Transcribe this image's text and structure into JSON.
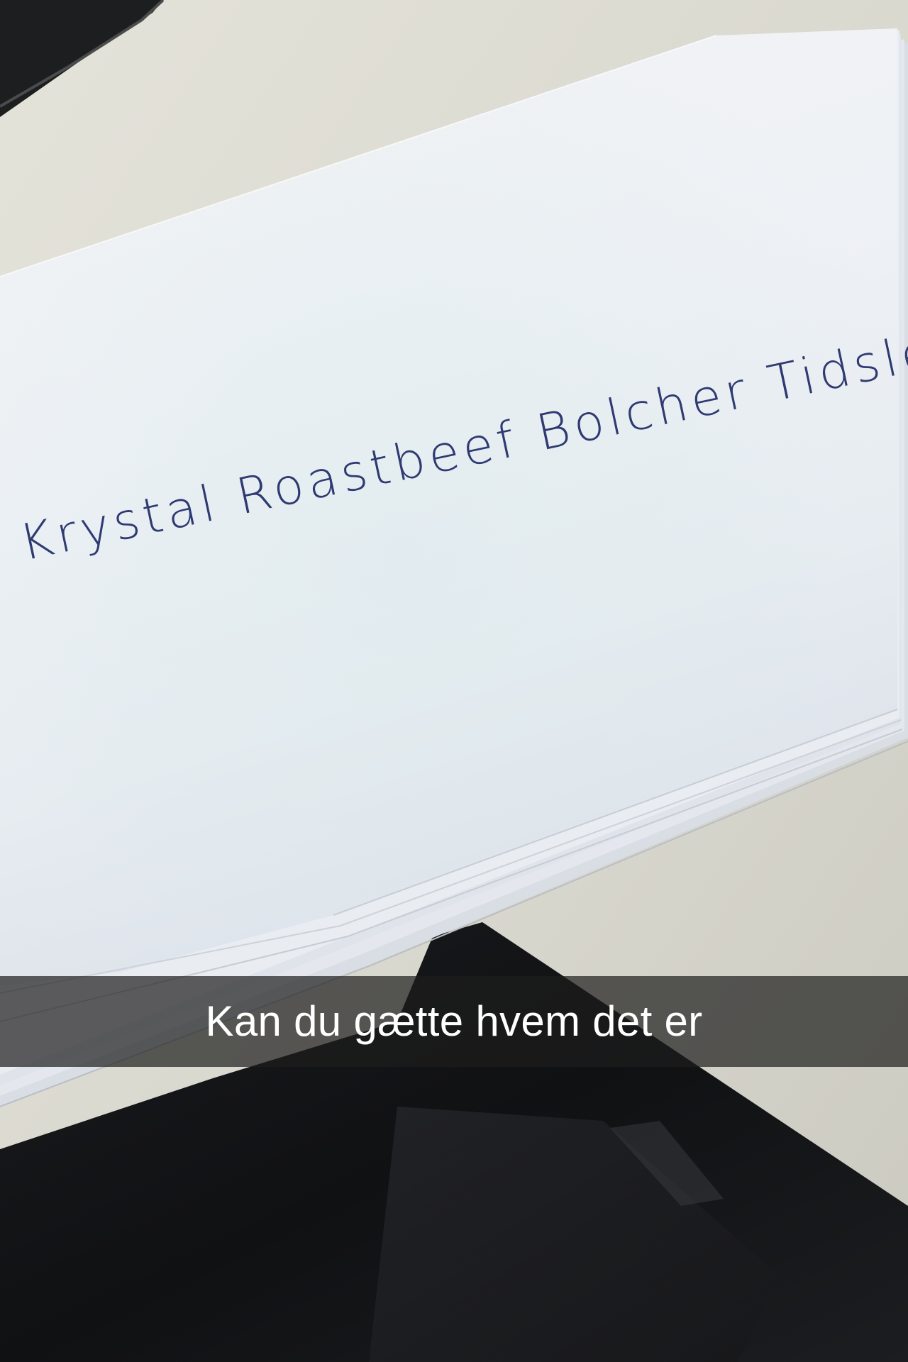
{
  "photo": {
    "handwritten_note": "Krystal Roastbeef Bolcher Tidsler",
    "ink_color": "#2f3a72",
    "paper_color": "#eef0f4",
    "desk_color": "#dcdbd2",
    "tablet_color": "#0f1012"
  },
  "caption": {
    "text": "Kan du gætte hvem det er"
  }
}
